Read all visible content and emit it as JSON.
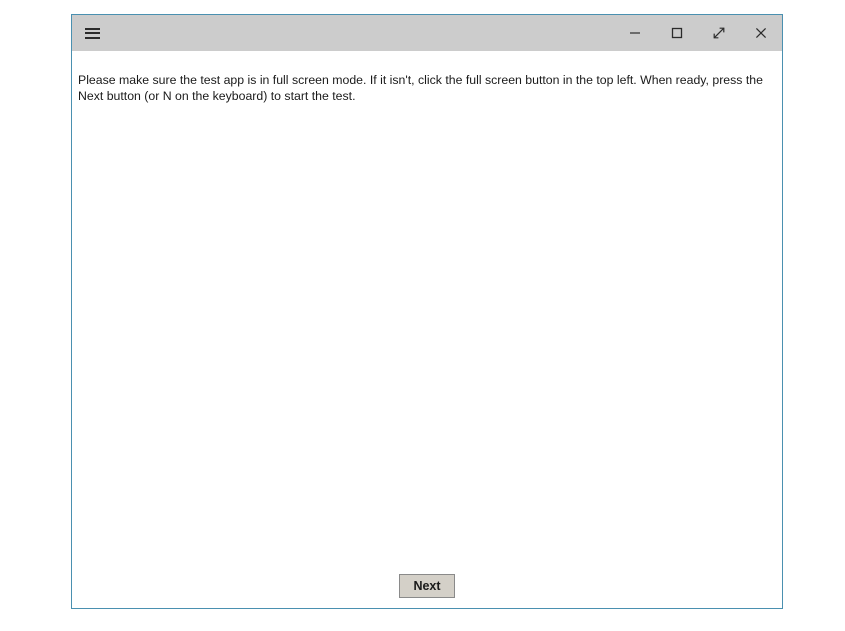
{
  "window": {
    "border_color": "#4a90b0",
    "titlebar_color": "#cccccc",
    "content_color": "#ffffff"
  },
  "titlebar": {
    "menu_icon": "hamburger-menu-icon",
    "menu_label": "",
    "controls": [
      {
        "name": "minimize",
        "icon": "minimize-icon",
        "label": ""
      },
      {
        "name": "maximize",
        "icon": "maximize-square-icon",
        "label": ""
      },
      {
        "name": "fullscreen",
        "icon": "fullscreen-diagonal-arrows-icon",
        "label": ""
      },
      {
        "name": "close",
        "icon": "close-x-icon",
        "label": ""
      }
    ]
  },
  "content": {
    "instruction": "Please make sure the test app is in full screen mode. If it isn't, click the full screen button in the top left. When ready, press the Next button (or N on the keyboard) to start the test."
  },
  "footer": {
    "next_label": "Next"
  }
}
